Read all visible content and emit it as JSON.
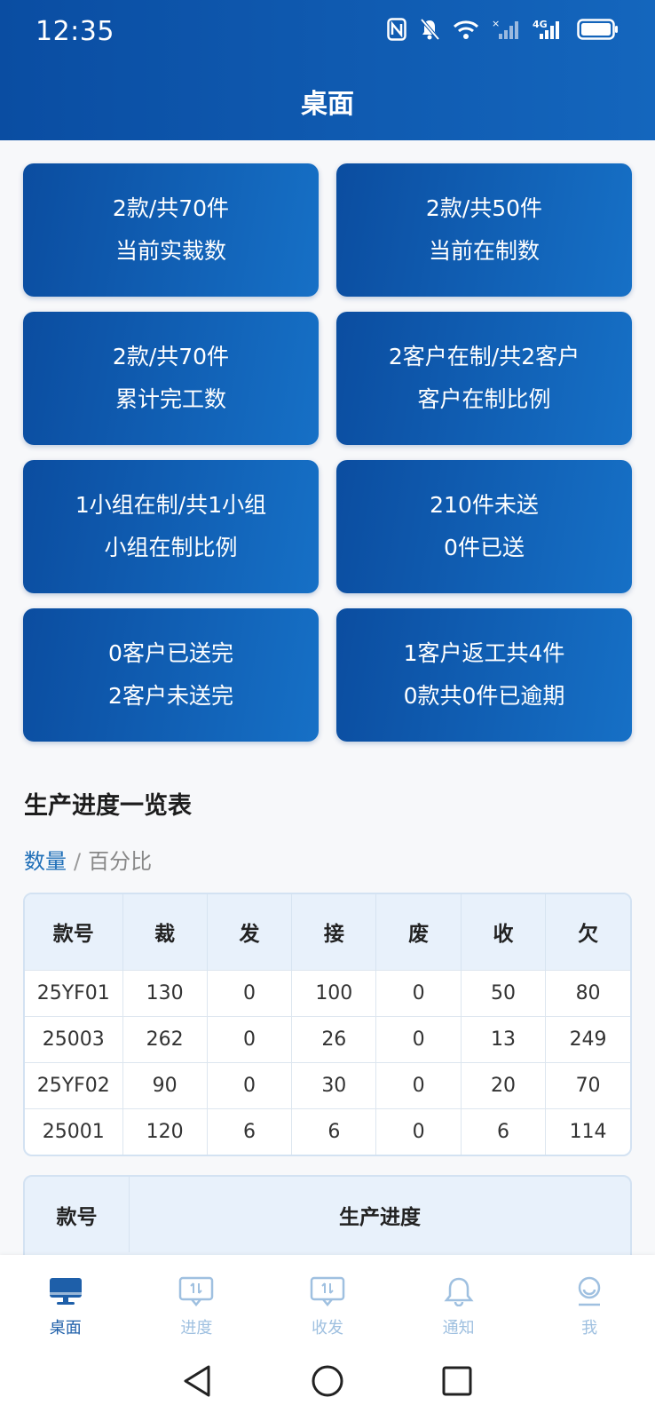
{
  "status": {
    "time": "12:35",
    "network": "4G"
  },
  "header": {
    "title": "桌面"
  },
  "cards": [
    {
      "line1": "2款/共70件",
      "line2": "当前实裁数"
    },
    {
      "line1": "2款/共50件",
      "line2": "当前在制数"
    },
    {
      "line1": "2款/共70件",
      "line2": "累计完工数"
    },
    {
      "line1": "2客户在制/共2客户",
      "line2": "客户在制比例"
    },
    {
      "line1": "1小组在制/共1小组",
      "line2": "小组在制比例"
    },
    {
      "line1": "210件未送",
      "line2": "0件已送"
    },
    {
      "line1": "0客户已送完",
      "line2": "2客户未送完"
    },
    {
      "line1": "1客户返工共4件",
      "line2": "0款共0件已逾期"
    }
  ],
  "section": {
    "title": "生产进度一览表",
    "toggle_active": "数量",
    "toggle_sep": "/",
    "toggle_inactive": "百分比"
  },
  "table": {
    "headers": [
      "款号",
      "裁",
      "发",
      "接",
      "废",
      "收",
      "欠"
    ],
    "rows": [
      [
        "25YF01",
        "130",
        "0",
        "100",
        "0",
        "50",
        "80"
      ],
      [
        "25003",
        "262",
        "0",
        "26",
        "0",
        "13",
        "249"
      ],
      [
        "25YF02",
        "90",
        "0",
        "30",
        "0",
        "20",
        "70"
      ],
      [
        "25001",
        "120",
        "6",
        "6",
        "0",
        "6",
        "114"
      ]
    ]
  },
  "progress_table": {
    "headers": [
      "款号",
      "生产进度"
    ]
  },
  "tabbar": [
    {
      "label": "桌面",
      "icon": "desktop-icon",
      "active": true
    },
    {
      "label": "进度",
      "icon": "progress-icon",
      "active": false
    },
    {
      "label": "收发",
      "icon": "transfer-icon",
      "active": false
    },
    {
      "label": "通知",
      "icon": "bell-icon",
      "active": false
    },
    {
      "label": "我",
      "icon": "user-icon",
      "active": false
    }
  ],
  "colors": {
    "primary": "#0b4da0",
    "accent": "#1670c6",
    "tab_active": "#1e5fa9",
    "tab_inactive": "#9fc0e0"
  }
}
